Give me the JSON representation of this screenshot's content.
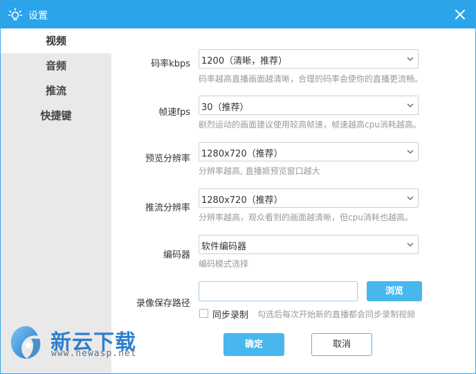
{
  "window": {
    "title": "设置",
    "colors": {
      "titlebar": "#2aa4ea",
      "button": "#48b7ee",
      "sidebar": "#e9e9e9"
    }
  },
  "sidebar": {
    "items": [
      {
        "label": "视频",
        "active": true
      },
      {
        "label": "音频",
        "active": false
      },
      {
        "label": "推流",
        "active": false
      },
      {
        "label": "快捷键",
        "active": false
      }
    ]
  },
  "settings": {
    "bitrate": {
      "label": "码率kbps",
      "value": "1200（清晰，推荐）",
      "hint": "码率越高直播画面越清晰，合理的码率会使你的直播更流畅。"
    },
    "fps": {
      "label": "帧速fps",
      "value": "30（推荐）",
      "hint": "剧烈运动的画面建议使用较高帧速，帧速越高cpu消耗越高。"
    },
    "preview_resolution": {
      "label": "预览分辨率",
      "value": "1280x720（推荐）",
      "hint": "分辨率越高, 直播姬预览窗口越大"
    },
    "stream_resolution": {
      "label": "推流分辨率",
      "value": "1280x720（推荐）",
      "hint": "分辨率越高，观众看到的画面越清晰，但cpu消耗也越高。"
    },
    "encoder": {
      "label": "编码器",
      "value": "软件编码器",
      "hint": "编码模式选择"
    },
    "record_path": {
      "label": "录像保存路径",
      "value": "",
      "browse_label": "浏览",
      "sync_record_label": "同步录制",
      "sync_record_checked": false,
      "sync_record_hint": "勾选后每次开始新的直播都会同步录制视频"
    }
  },
  "footer": {
    "ok_label": "确定",
    "cancel_label": "取消"
  },
  "watermark": {
    "name": "新云下载",
    "url": "www.newasp.net"
  },
  "icons": {
    "app": "lightbulb-icon",
    "close": "close-icon",
    "dropdown": "chevron-down-icon"
  }
}
